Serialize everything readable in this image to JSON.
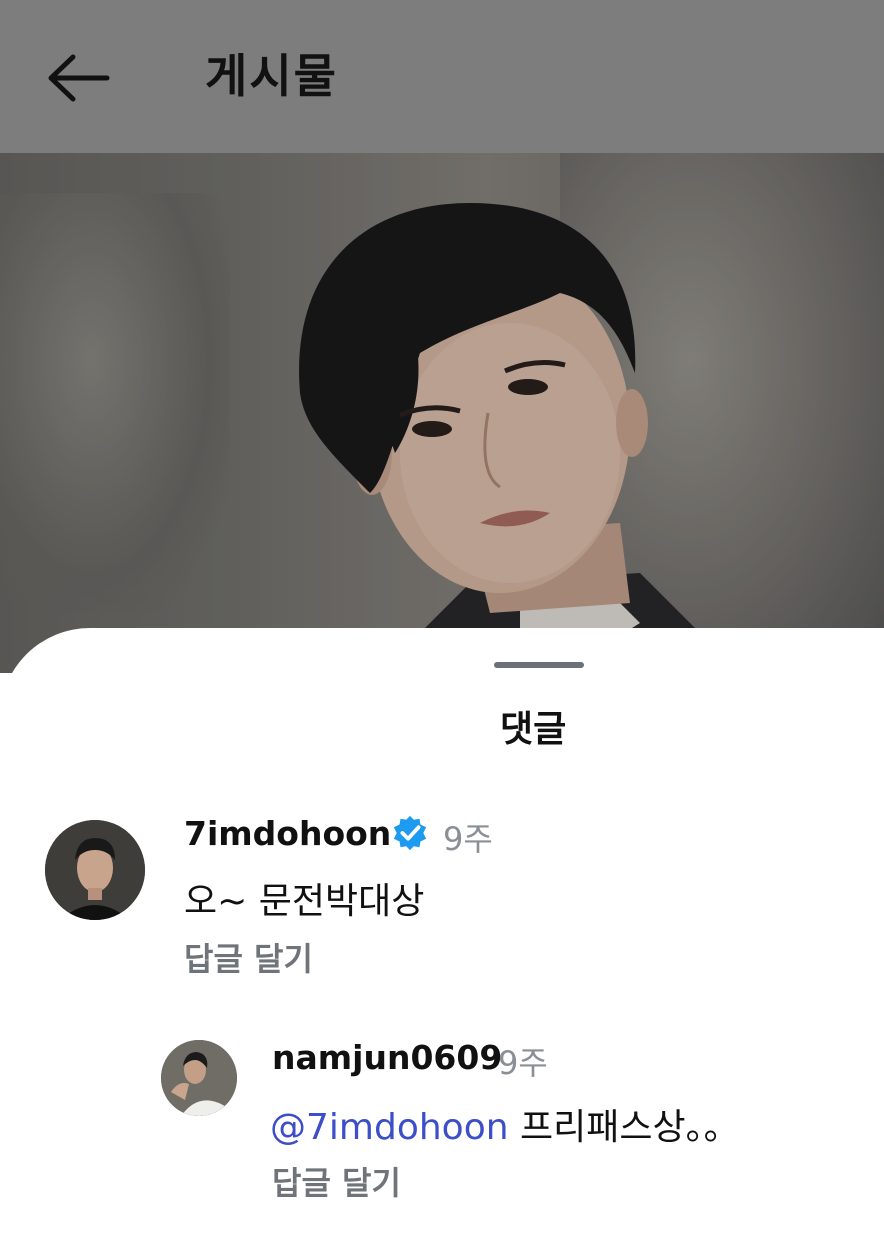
{
  "header": {
    "title": "게시물",
    "back_icon": "arrow-left-icon"
  },
  "sheet": {
    "title": "댓글"
  },
  "comments": [
    {
      "username": "7imdohoon",
      "verified": true,
      "time": "9주",
      "text": "오~ 문전박대상",
      "reply_label": "답글 달기"
    }
  ],
  "replies": [
    {
      "username": "namjun0609",
      "time": "9주",
      "mention": "@7imdohoon",
      "text": "프리패스상。。",
      "reply_label": "답글 달기"
    }
  ],
  "colors": {
    "header_bg": "#7d7d7d",
    "mention": "#3d4ec9",
    "verified_badge": "#1d9bf0",
    "secondary_text": "#8a8f96"
  }
}
